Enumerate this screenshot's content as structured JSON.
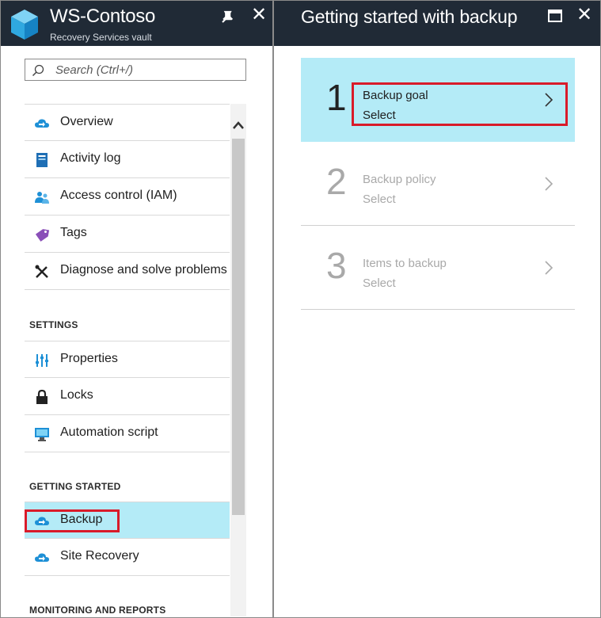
{
  "vault": {
    "title": "WS-Contoso",
    "subtitle": "Recovery Services vault"
  },
  "search": {
    "placeholder": "Search (Ctrl+/)"
  },
  "menu": {
    "top_items": [
      {
        "label": "Overview",
        "icon": "cloud-icon"
      },
      {
        "label": "Activity log",
        "icon": "activity-log-icon"
      },
      {
        "label": "Access control (IAM)",
        "icon": "users-icon"
      },
      {
        "label": "Tags",
        "icon": "tag-icon"
      },
      {
        "label": "Diagnose and solve problems",
        "icon": "wrench-icon"
      }
    ],
    "settings_header": "SETTINGS",
    "settings_items": [
      {
        "label": "Properties",
        "icon": "sliders-icon"
      },
      {
        "label": "Locks",
        "icon": "lock-icon"
      },
      {
        "label": "Automation script",
        "icon": "monitor-icon"
      }
    ],
    "getting_started_header": "GETTING STARTED",
    "getting_started_items": [
      {
        "label": "Backup",
        "icon": "cloud-icon",
        "selected": true
      },
      {
        "label": "Site Recovery",
        "icon": "cloud-icon"
      }
    ],
    "monitoring_header": "MONITORING AND REPORTS"
  },
  "blade": {
    "title": "Getting started with backup",
    "steps": [
      {
        "number": "1",
        "title": "Backup goal",
        "value": "Select",
        "state": "active"
      },
      {
        "number": "2",
        "title": "Backup policy",
        "value": "Select",
        "state": "disabled"
      },
      {
        "number": "3",
        "title": "Items to backup",
        "value": "Select",
        "state": "disabled"
      }
    ]
  },
  "colors": {
    "header_bg": "#202a36",
    "selected_bg": "#b4ebf7",
    "highlight": "#d91b2a",
    "icon_blue": "#1e90d6"
  }
}
